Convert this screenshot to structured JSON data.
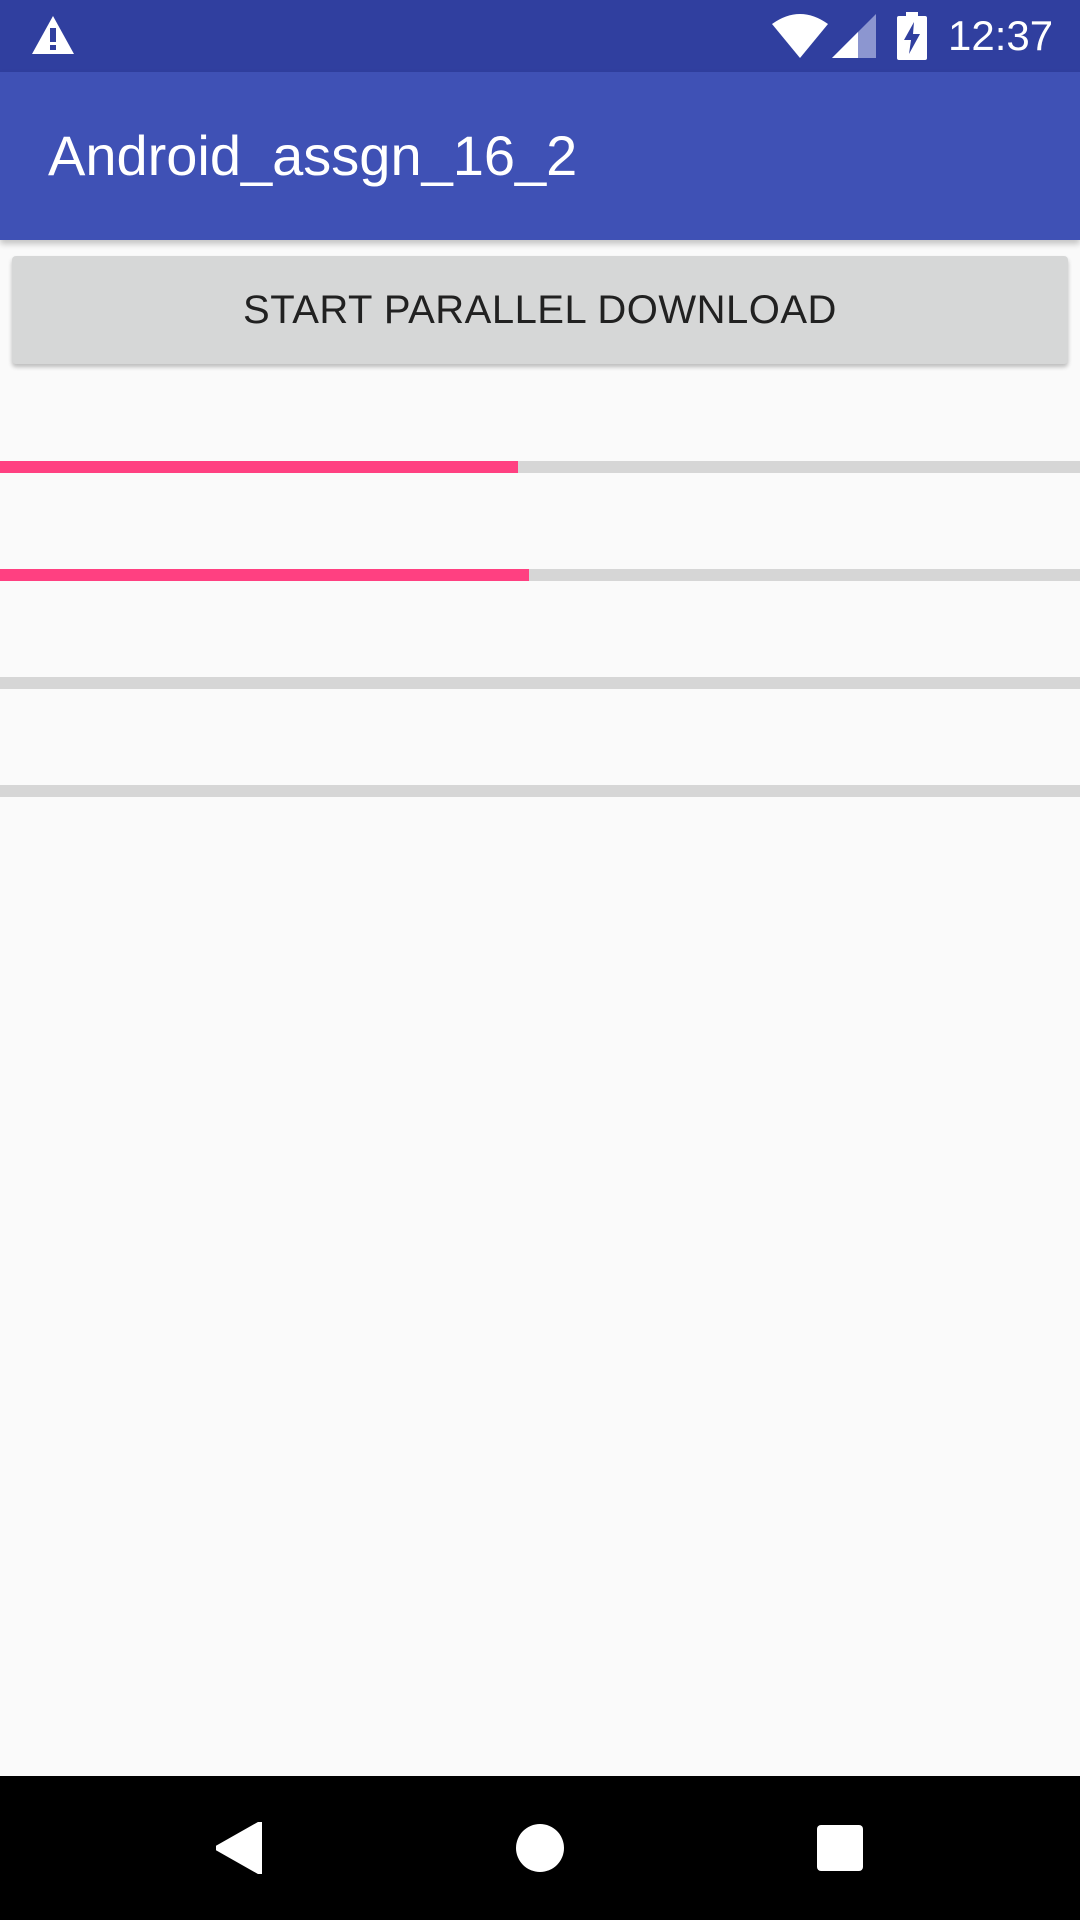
{
  "status_bar": {
    "time": "12:37",
    "icons": [
      "warning-icon",
      "wifi-icon",
      "cell-signal-icon",
      "battery-charging-icon"
    ]
  },
  "app_bar": {
    "title": "Android_assgn_16_2"
  },
  "main": {
    "button_label": "START PARALLEL DOWNLOAD",
    "progress_bars": [
      {
        "progress": 0.48
      },
      {
        "progress": 0.49
      },
      {
        "progress": 0.0
      },
      {
        "progress": 0.0
      }
    ]
  },
  "nav_bar": {
    "icons": [
      "back-icon",
      "home-icon",
      "recents-icon"
    ]
  },
  "colors": {
    "status_bar": "#303f9f",
    "primary": "#3f51b5",
    "accent": "#ff4081",
    "track": "#d6d6d6",
    "background": "#fafafa"
  }
}
